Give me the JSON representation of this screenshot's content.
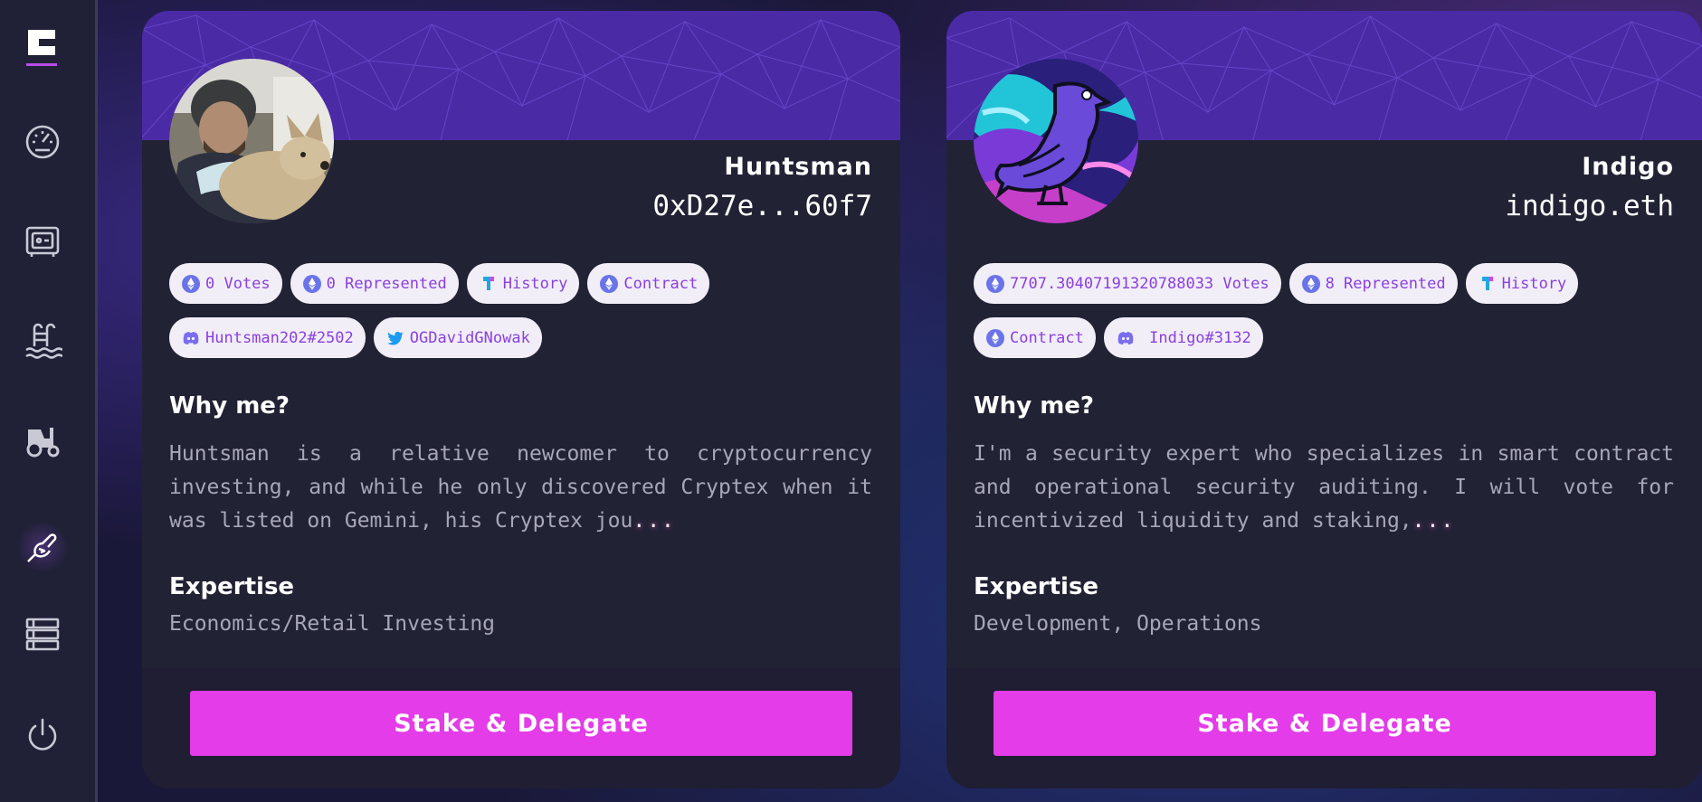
{
  "sidebar": {
    "items": [
      {
        "icon": "logo-icon"
      },
      {
        "icon": "dashboard-gauge-icon"
      },
      {
        "icon": "vault-icon"
      },
      {
        "icon": "pool-icon"
      },
      {
        "icon": "farm-tractor-icon"
      },
      {
        "icon": "governance-hand-icon",
        "active": true
      },
      {
        "icon": "list-icon"
      },
      {
        "icon": "power-icon"
      }
    ]
  },
  "delegates": [
    {
      "name": "Huntsman",
      "address": "0xD27e...60f7",
      "votes_label": "0 Votes",
      "represented_label": "0 Represented",
      "history_label": "History",
      "contract_label": "Contract",
      "discord_label": "Huntsman202#2502",
      "twitter_label": "OGDavidGNowak",
      "why_title": "Why me?",
      "why_text": "Huntsman is a relative newcomer to cryptocurrency investing, and while he only discovered Cryptex when it was listed on Gemini, his Cryptex jou",
      "more": "...",
      "expertise_title": "Expertise",
      "expertise": "Economics/Retail Investing",
      "button_label": "Stake & Delegate"
    },
    {
      "name": "Indigo",
      "address": "indigo.eth",
      "votes_label": "7707.30407191320788033 Votes",
      "represented_label": "8 Represented",
      "history_label": "History",
      "contract_label": "Contract",
      "discord_label": " Indigo#3132",
      "why_title": "Why me?",
      "why_text": "I'm a security expert who specializes in smart contract and operational security auditing. I will vote for incentivized liquidity and staking,",
      "more": "...",
      "expertise_title": "Expertise",
      "expertise": "Development, Operations",
      "button_label": "Stake & Delegate"
    }
  ],
  "colors": {
    "accent": "#e33ce8",
    "pill_text": "#8a3fe0",
    "banner": "#4b2aa6",
    "card": "#222235",
    "sidebar": "#202036"
  }
}
